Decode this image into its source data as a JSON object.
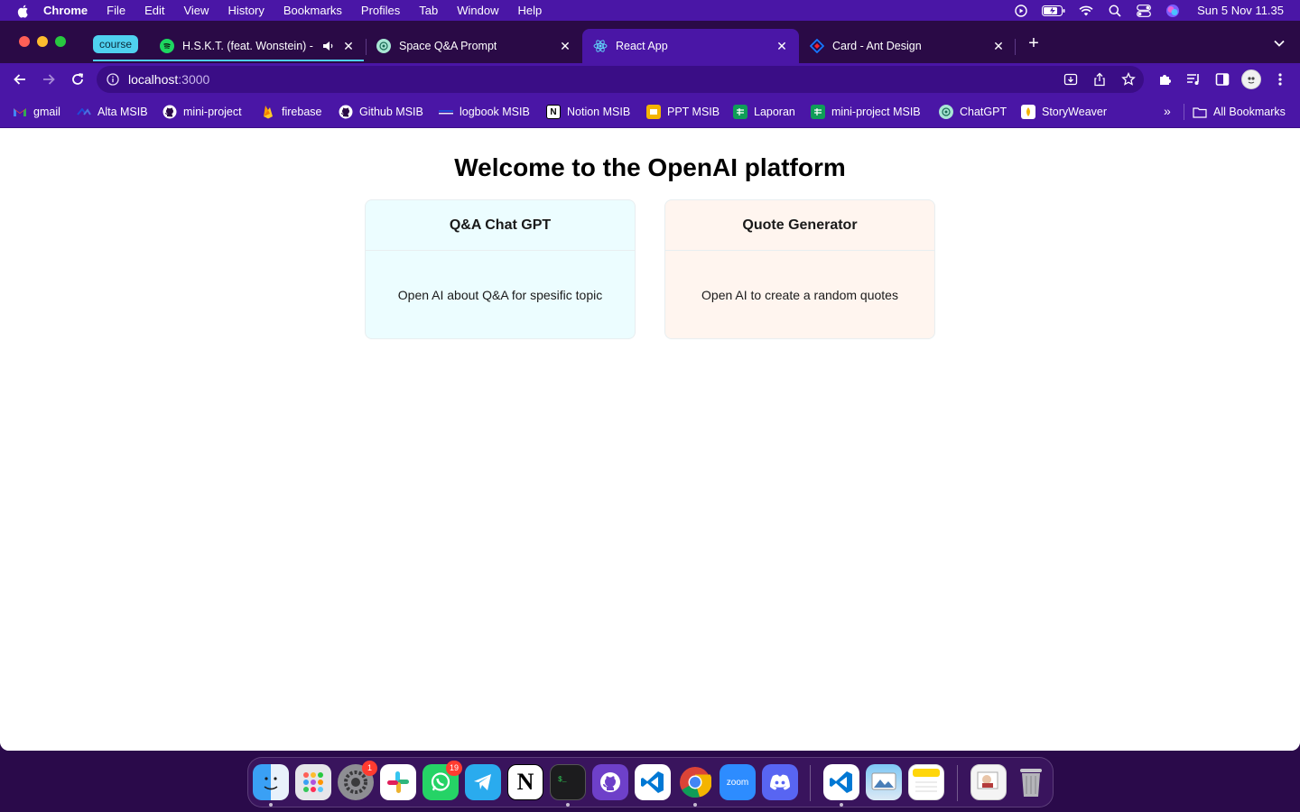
{
  "menubar": {
    "app_name": "Chrome",
    "items": [
      "File",
      "Edit",
      "View",
      "History",
      "Bookmarks",
      "Profiles",
      "Tab",
      "Window",
      "Help"
    ],
    "clock": "Sun 5 Nov  11.35"
  },
  "tab_group": {
    "label": "course",
    "color": "#4fd1f0"
  },
  "tabs": [
    {
      "title": "H.S.K.T. (feat. Wonstein) -",
      "icon": "spotify-icon",
      "audio": true
    },
    {
      "title": "Space Q&A Prompt",
      "icon": "openai-icon"
    },
    {
      "title": "React App",
      "icon": "react-icon",
      "active": true
    },
    {
      "title": "Card - Ant Design",
      "icon": "ant-design-icon"
    }
  ],
  "address_bar": {
    "host": "localhost",
    "port": ":3000"
  },
  "bookmarks": [
    {
      "label": "gmail",
      "icon": "gmail-icon"
    },
    {
      "label": "Alta MSIB",
      "icon": "alta-icon"
    },
    {
      "label": "mini-project",
      "icon": "github-icon"
    },
    {
      "label": "firebase",
      "icon": "firebase-icon"
    },
    {
      "label": "Github MSIB",
      "icon": "github-icon"
    },
    {
      "label": "logbook MSIB",
      "icon": "logbook-icon"
    },
    {
      "label": "Notion MSIB",
      "icon": "notion-icon"
    },
    {
      "label": "PPT MSIB",
      "icon": "slides-icon"
    },
    {
      "label": "Laporan",
      "icon": "sheets-icon"
    },
    {
      "label": "mini-project MSIB",
      "icon": "sheets-icon"
    },
    {
      "label": "ChatGPT",
      "icon": "openai-icon"
    },
    {
      "label": "StoryWeaver",
      "icon": "storyweaver-icon"
    }
  ],
  "all_bookmarks_label": "All Bookmarks",
  "page": {
    "title": "Welcome to the OpenAI platform",
    "cards": [
      {
        "title": "Q&A Chat GPT",
        "description": "Open AI about Q&A for spesific topic",
        "bg": "#ecfdff"
      },
      {
        "title": "Quote Generator",
        "description": "Open AI to create a random quotes",
        "bg": "#fff5ef"
      }
    ]
  },
  "dock": {
    "apps": [
      "finder-icon",
      "launchpad-icon",
      "system-settings-icon",
      "slack-icon",
      "whatsapp-icon",
      "telegram-icon",
      "notion-icon",
      "terminal-icon",
      "github-desktop-icon",
      "vscode-icon",
      "chrome-icon",
      "zoom-icon",
      "discord-icon",
      "vscode-icon",
      "preview-icon",
      "notes-icon",
      "photos-icon",
      "trash-icon"
    ],
    "badges": {
      "system_settings": "1",
      "whatsapp": "19"
    },
    "zoom_label": "zoom"
  },
  "colors": {
    "accent": "#4a16a6",
    "tabstrip": "#2a0a46"
  }
}
